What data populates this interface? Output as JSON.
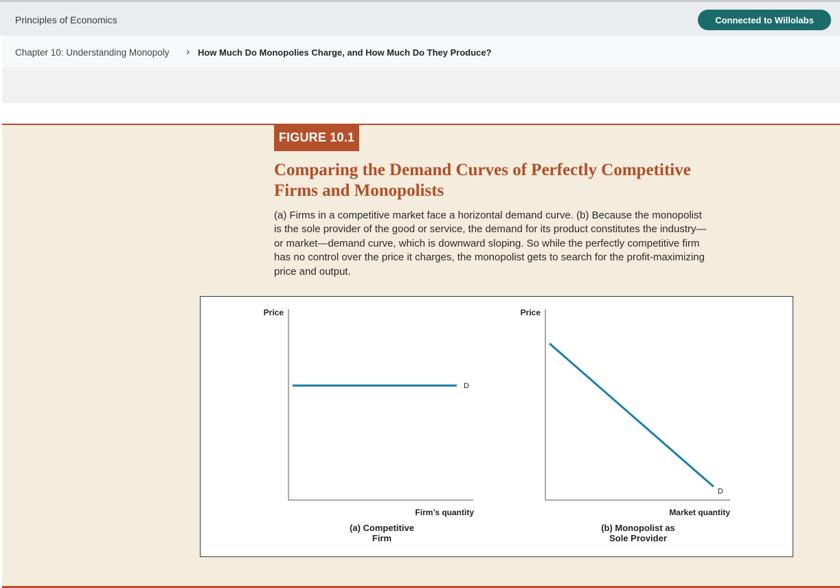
{
  "topbar": {
    "book_title": "Principles of Economics",
    "connect_label": "Connected to Willolabs",
    "connect_color": "#1c6b6b"
  },
  "breadcrumb": {
    "chapter": "Chapter 10: Understanding Monopoly",
    "separator": "›",
    "current": "How Much Do Monopolies Charge, and How Much Do They Produce?"
  },
  "figure": {
    "badge": "FIGURE 10.1",
    "title": "Comparing the Demand Curves of Perfectly Competitive Firms and Monopolists",
    "caption": "(a) Firms in a competitive market face a horizontal demand curve. (b) Because the monopolist is the sole provider of the good or service, the demand for its product constitutes the industry—or market—demand curve, which is downward sloping. So while the perfectly competitive firm has no control over the price it charges, the monopolist gets to search for the profit-maximizing price and output.",
    "accent_color": "#b5502a",
    "curve_color": "#1a7fa8"
  },
  "chart_data": [
    {
      "type": "line",
      "ylabel": "Price",
      "xlabel": "Firm’s quantity",
      "caption_line1": "(a) Competitive",
      "caption_line2": "Firm",
      "series": [
        {
          "name": "D",
          "x": [
            0,
            1
          ],
          "y": [
            0.6,
            0.6
          ]
        }
      ],
      "xlim": [
        0,
        1
      ],
      "ylim": [
        0,
        1
      ]
    },
    {
      "type": "line",
      "ylabel": "Price",
      "xlabel": "Market quantity",
      "caption_line1": "(b) Monopolist as",
      "caption_line2": "Sole Provider",
      "series": [
        {
          "name": "D",
          "x": [
            0,
            1
          ],
          "y": [
            0.82,
            0.07
          ]
        }
      ],
      "xlim": [
        0,
        1
      ],
      "ylim": [
        0,
        1
      ]
    }
  ]
}
